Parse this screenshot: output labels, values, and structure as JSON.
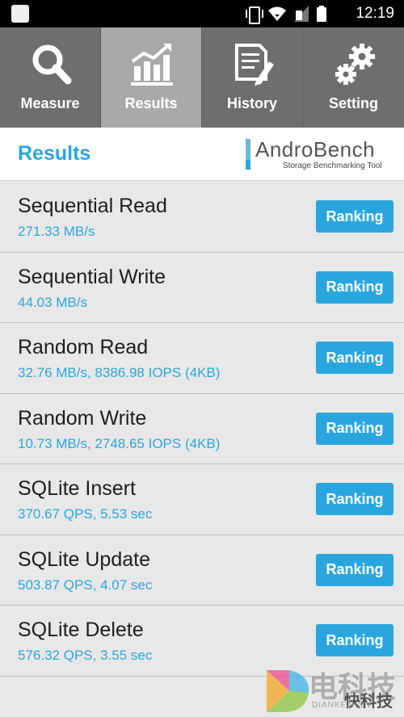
{
  "status_bar": {
    "time": "12:19"
  },
  "tabs": [
    {
      "label": "Measure",
      "icon": "magnifier-icon",
      "active": false
    },
    {
      "label": "Results",
      "icon": "bar-chart-icon",
      "active": true
    },
    {
      "label": "History",
      "icon": "document-pencil-icon",
      "active": false
    },
    {
      "label": "Setting",
      "icon": "gears-icon",
      "active": false
    }
  ],
  "header": {
    "title": "Results",
    "logo_text": "AndroBench",
    "logo_subtitle": "Storage Benchmarking Tool"
  },
  "results": [
    {
      "name": "Sequential Read",
      "value": "271.33 MB/s",
      "button": "Ranking"
    },
    {
      "name": "Sequential Write",
      "value": "44.03 MB/s",
      "button": "Ranking"
    },
    {
      "name": "Random Read",
      "value": "32.76 MB/s, 8386.98 IOPS (4KB)",
      "button": "Ranking"
    },
    {
      "name": "Random Write",
      "value": "10.73 MB/s, 2748.65 IOPS (4KB)",
      "button": "Ranking"
    },
    {
      "name": "SQLite Insert",
      "value": "370.67 QPS, 5.53 sec",
      "button": "Ranking"
    },
    {
      "name": "SQLite Update",
      "value": "503.87 QPS, 4.07 sec",
      "button": "Ranking"
    },
    {
      "name": "SQLite Delete",
      "value": "576.32 QPS, 3.55 sec",
      "button": "Ranking"
    }
  ],
  "watermark": {
    "text": "电科技",
    "brand": "快科技",
    "sub": "DIANKEJI.CN"
  },
  "colors": {
    "accent": "#2aa6df",
    "tab_bg": "#6e6e6e",
    "tab_active": "#a9a9a9"
  }
}
